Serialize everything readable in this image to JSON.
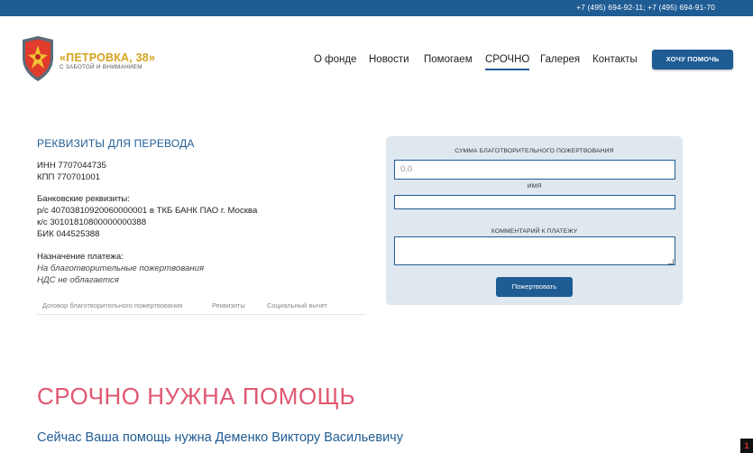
{
  "topbar": {
    "phones": "+7 (495) 694-92-11; +7 (495) 694-91-70"
  },
  "logo": {
    "name": "«ПЕТРОВКА, 38»",
    "tagline": "С ЗАБОТОЙ И ВНИМАНИЕМ"
  },
  "nav": {
    "items": [
      {
        "label": "О фонде"
      },
      {
        "label": "Новости"
      },
      {
        "label": "Помогаем"
      },
      {
        "label": "СРОЧНО",
        "active": true
      },
      {
        "label": "Галерея"
      },
      {
        "label": "Контакты"
      }
    ],
    "help_button": "ХОЧУ ПОМОЧЬ"
  },
  "requisites": {
    "title": "РЕКВИЗИТЫ ДЛЯ ПЕРЕВОДА",
    "inn": "ИНН 7707044735",
    "kpp": "КПП 770701001",
    "bank_label": "Банковские реквизиты:",
    "account": "р/с 40703810920060000001 в ТКБ БАНК ПАО г. Москва",
    "corr": "к/с 30101810800000000388",
    "bik": "БИК 044525388",
    "purpose_label": "Назначение платежа:",
    "purpose": "На благотворительные пожертвования",
    "vat": "НДС не облагается",
    "tabs": [
      "Договор благотворительного пожертвования",
      "Реквизиты",
      "Социальный вычет"
    ]
  },
  "form": {
    "amount_label": "СУММА БЛАГОТВОРИТЕЛЬНОГО ПОЖЕРТВОВАНИЯ",
    "amount_value": "0.0",
    "name_label": "ИМЯ",
    "name_value": "",
    "comment_label": "КОММЕНТАРИЙ К ПЛАТЕЖУ",
    "comment_value": "",
    "submit": "Пожертвовать"
  },
  "urgent": {
    "title": "СРОЧНО НУЖНА ПОМОЩЬ",
    "subtitle": "Сейчас Ваша помощь нужна Деменко Виктору Васильевичу"
  },
  "corner_badge": "1",
  "colors": {
    "brand": "#1f5c94",
    "accent_gold": "#d6a21e",
    "urgent": "#e05872",
    "form_bg": "#dfe7ef"
  }
}
